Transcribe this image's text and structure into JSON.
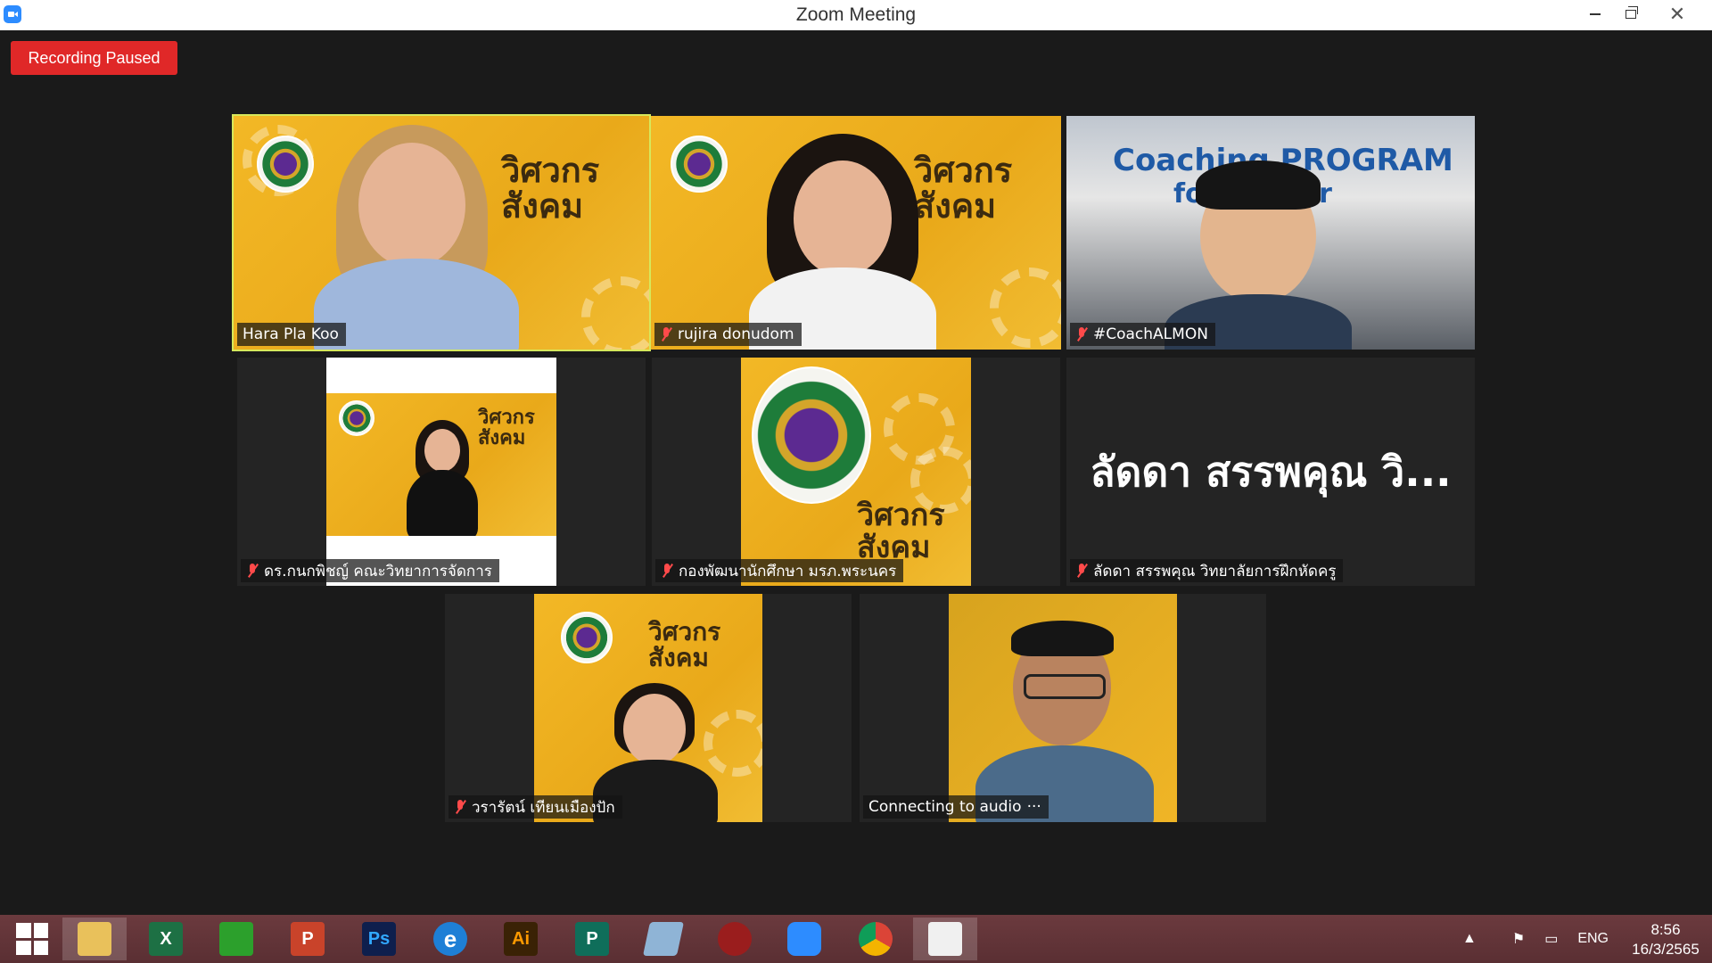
{
  "window": {
    "title": "Zoom Meeting",
    "minimize_label": "",
    "close_glyph": "✕"
  },
  "recording": {
    "status": "Recording Paused",
    "color": "#e02828"
  },
  "active_speaker_outline": "#d6e85b",
  "tiles": [
    {
      "name": "Hara Pla Koo",
      "muted": false,
      "active": true
    },
    {
      "name": "rujira donudom",
      "muted": true
    },
    {
      "name": "#CoachALMON",
      "muted": true,
      "video_text": {
        "line1": "Coaching PROGRAM",
        "line2": "for Trainer"
      }
    },
    {
      "name": "ดร.กนกพิชญ์ คณะวิทยาการจัดการ",
      "muted": true
    },
    {
      "name": "กองพัฒนานักศึกษา มรภ.พระนคร",
      "muted": true
    },
    {
      "name": "ลัดดา สรรพคุณ วิทยาลัยการฝึกหัดครู",
      "muted": true,
      "display_name": "ลัดดา สรรพคุณ วิ..."
    },
    {
      "name": "วรารัตน์ เทียนเมืองปัก",
      "muted": true
    },
    {
      "name": "Connecting to audio",
      "muted": false,
      "status_glyph": "···"
    }
  ],
  "banner": {
    "line1": "วิศวกร",
    "line2": "สังคม"
  },
  "taskbar": {
    "apps": [
      {
        "icon": "windows-start-icon"
      },
      {
        "icon": "file-explorer-icon",
        "active": true
      },
      {
        "icon": "excel-icon",
        "label": "X",
        "color": "#1d7044"
      },
      {
        "icon": "store-icon",
        "label": "",
        "color": "#2ca02c"
      },
      {
        "icon": "powerpoint-icon",
        "label": "P",
        "color": "#c9432a"
      },
      {
        "icon": "photoshop-icon",
        "label": "Ps",
        "color": "#0e1f4d"
      },
      {
        "icon": "internet-explorer-icon",
        "label": "e",
        "color": "#1e7fd6"
      },
      {
        "icon": "illustrator-icon",
        "label": "Ai",
        "color": "#3a2205"
      },
      {
        "icon": "publisher-icon",
        "label": "P",
        "color": "#0f6e5a"
      },
      {
        "icon": "notes-icon",
        "label": "",
        "color": "#8fb4d6"
      },
      {
        "icon": "photoscape-icon",
        "label": "",
        "color": "#9a1d1d"
      },
      {
        "icon": "zoom-icon",
        "label": "",
        "color": "#2d8cff"
      },
      {
        "icon": "chrome-icon",
        "label": "",
        "color": "#e8e8e8"
      },
      {
        "icon": "photos-icon",
        "label": "",
        "color": "#f0f0f0",
        "active": true
      }
    ],
    "tray": {
      "language": "ENG",
      "time": "8:56",
      "date": "16/3/2565"
    }
  }
}
